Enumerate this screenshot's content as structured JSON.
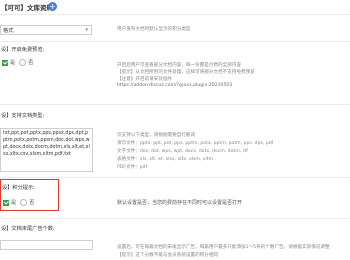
{
  "header": {
    "title": "【可可】文库资料"
  },
  "format_select": {
    "value": "格式"
  },
  "top_help": "用户发布文档时默认显示的积分类型",
  "preview": {
    "label": "设】开启免费预览:",
    "options": [
      "是",
      "否"
    ],
    "help": [
      "开启后用户可查看部分文档内容，每一份都是付费的全部内容",
      "【提示】从文档所附的文件处理，这样可将部分文档不支持免费预览",
      "【注意】开启前请安装插件",
      "https://addon.discuz.com/?@xxx.plugin.20210503"
    ]
  },
  "formats": {
    "label": "设】支持文档类型:",
    "value": "txt,ppt,pot,pptx,pps,ppsx,dps,dpt,pptm,potx,potm,ppsm,doc,dot,wps,wpt,docx,dotx,docm,dotm,xls,xlt,et,xlsx,xltx,csv,xlsm,xltm,pdf,txt",
    "help": [
      "仅支持以下类型，请根据需要自行删减",
      "演示文件：pptx, ppt, pot, pps, pptm, potx, pptm, potm, pps, dps, pdf",
      "文字文件：doc, dot, wps, wpt, docx, dotx, docm, dotm, rtf",
      "表格文件：xls, xlt, et, xlsx, xltx, xlsm, xltm",
      "PDF文件：pdf"
    ]
  },
  "scoring": {
    "label": "设】积分提示:",
    "options": [
      "是",
      "否"
    ],
    "help": "默认设置是否，当您的费前存在不同时可以设置是否打开"
  },
  "ad": {
    "label": "设】文档末尾广告个数:",
    "help": [
      "设置后，可在每篇文档的末尾显示广告，每篇用户最多只能添加1～5条的个数广告，请根据实际情况调整",
      "【提示】这个分数不能与会员系统设置的积分相同"
    ]
  }
}
